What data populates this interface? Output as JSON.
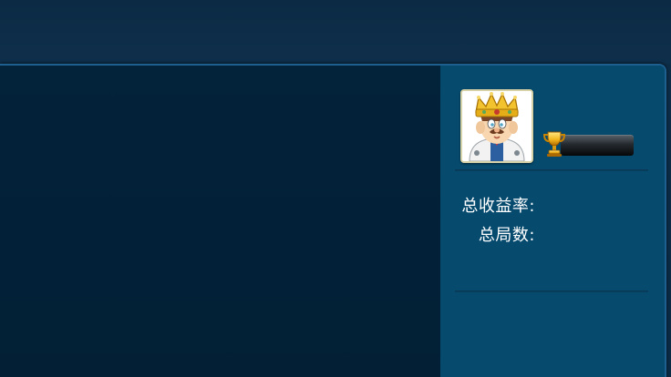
{
  "stats": {
    "total_return_label": "总收益率:",
    "total_rounds_label": "总局数:"
  },
  "icons": {
    "avatar": "king-avatar-icon",
    "trophy": "trophy-icon"
  },
  "colors": {
    "background": "#0b2b45",
    "left_panel": "#02213a",
    "right_panel": "#064a6e",
    "border": "#1d5f8e",
    "text": "#ffffff"
  }
}
